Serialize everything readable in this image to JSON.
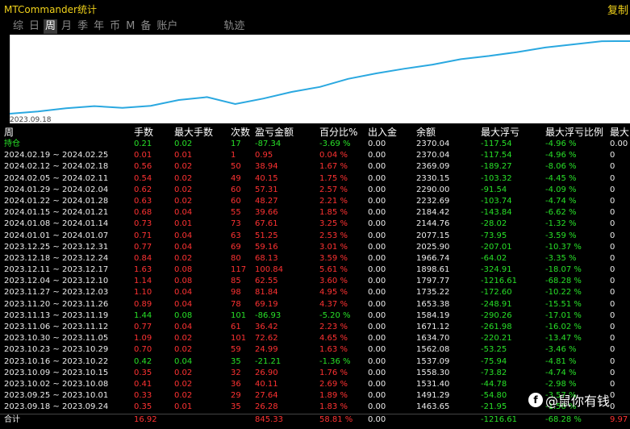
{
  "app": {
    "title": "MTCommander统计",
    "top_right": "复制"
  },
  "tabs": [
    {
      "label": "综",
      "active": false
    },
    {
      "label": "日",
      "active": false
    },
    {
      "label": "周",
      "active": true
    },
    {
      "label": "月",
      "active": false
    },
    {
      "label": "季",
      "active": false
    },
    {
      "label": "年",
      "active": false
    },
    {
      "label": "币",
      "active": false
    },
    {
      "label": "M",
      "active": false
    },
    {
      "label": "备",
      "active": false
    },
    {
      "label": "账户",
      "active": false
    },
    {
      "label": "轨迹",
      "active": false
    }
  ],
  "chart_data": {
    "type": "line",
    "x_start_label": "2023.09.18",
    "color": "#2aa8e0",
    "values": [
      1463.65,
      1491.29,
      1531.4,
      1558.3,
      1537.09,
      1562.08,
      1634.7,
      1671.12,
      1584.19,
      1653.38,
      1735.22,
      1797.77,
      1898.61,
      1966.74,
      2025.9,
      2077.15,
      2144.76,
      2184.42,
      2232.69,
      2290.0,
      2330.15,
      2369.09,
      2370.04
    ]
  },
  "table": {
    "headers": [
      "周",
      "手数",
      "最大手数",
      "次数",
      "盈亏金额",
      "百分比%",
      "出入金",
      "余额",
      "最大浮亏",
      "最大浮亏比例",
      "最大"
    ],
    "rows": [
      [
        "持仓",
        "0.21",
        "0.02",
        "17",
        "-87.34",
        "-3.69 %",
        "0.00",
        "2370.04",
        "-117.54",
        "-4.96 %",
        "0.00"
      ],
      [
        "2024.02.19 ~ 2024.02.25",
        "0.01",
        "0.01",
        "1",
        "0.95",
        "0.04 %",
        "0.00",
        "2370.04",
        "-117.54",
        "-4.96 %",
        "0"
      ],
      [
        "2024.02.12 ~ 2024.02.18",
        "0.56",
        "0.02",
        "50",
        "38.94",
        "1.67 %",
        "0.00",
        "2369.09",
        "-189.27",
        "-8.06 %",
        "0"
      ],
      [
        "2024.02.05 ~ 2024.02.11",
        "0.54",
        "0.02",
        "49",
        "40.15",
        "1.75 %",
        "0.00",
        "2330.15",
        "-103.32",
        "-4.45 %",
        "0"
      ],
      [
        "2024.01.29 ~ 2024.02.04",
        "0.62",
        "0.02",
        "60",
        "57.31",
        "2.57 %",
        "0.00",
        "2290.00",
        "-91.54",
        "-4.09 %",
        "0"
      ],
      [
        "2024.01.22 ~ 2024.01.28",
        "0.63",
        "0.02",
        "60",
        "48.27",
        "2.21 %",
        "0.00",
        "2232.69",
        "-103.74",
        "-4.74 %",
        "0"
      ],
      [
        "2024.01.15 ~ 2024.01.21",
        "0.68",
        "0.04",
        "55",
        "39.66",
        "1.85 %",
        "0.00",
        "2184.42",
        "-143.84",
        "-6.62 %",
        "0"
      ],
      [
        "2024.01.08 ~ 2024.01.14",
        "0.73",
        "0.01",
        "73",
        "67.61",
        "3.25 %",
        "0.00",
        "2144.76",
        "-28.02",
        "-1.32 %",
        "0"
      ],
      [
        "2024.01.01 ~ 2024.01.07",
        "0.71",
        "0.04",
        "63",
        "51.25",
        "2.53 %",
        "0.00",
        "2077.15",
        "-73.95",
        "-3.59 %",
        "0"
      ],
      [
        "2023.12.25 ~ 2023.12.31",
        "0.77",
        "0.04",
        "69",
        "59.16",
        "3.01 %",
        "0.00",
        "2025.90",
        "-207.01",
        "-10.37 %",
        "0"
      ],
      [
        "2023.12.18 ~ 2023.12.24",
        "0.84",
        "0.02",
        "80",
        "68.13",
        "3.59 %",
        "0.00",
        "1966.74",
        "-64.02",
        "-3.35 %",
        "0"
      ],
      [
        "2023.12.11 ~ 2023.12.17",
        "1.63",
        "0.08",
        "117",
        "100.84",
        "5.61 %",
        "0.00",
        "1898.61",
        "-324.91",
        "-18.07 %",
        "0"
      ],
      [
        "2023.12.04 ~ 2023.12.10",
        "1.14",
        "0.08",
        "85",
        "62.55",
        "3.60 %",
        "0.00",
        "1797.77",
        "-1216.61",
        "-68.28 %",
        "0"
      ],
      [
        "2023.11.27 ~ 2023.12.03",
        "1.10",
        "0.04",
        "98",
        "81.84",
        "4.95 %",
        "0.00",
        "1735.22",
        "-172.60",
        "-10.22 %",
        "0"
      ],
      [
        "2023.11.20 ~ 2023.11.26",
        "0.89",
        "0.04",
        "78",
        "69.19",
        "4.37 %",
        "0.00",
        "1653.38",
        "-248.91",
        "-15.51 %",
        "0"
      ],
      [
        "2023.11.13 ~ 2023.11.19",
        "1.44",
        "0.08",
        "101",
        "-86.93",
        "-5.20 %",
        "0.00",
        "1584.19",
        "-290.26",
        "-17.01 %",
        "0"
      ],
      [
        "2023.11.06 ~ 2023.11.12",
        "0.77",
        "0.04",
        "61",
        "36.42",
        "2.23 %",
        "0.00",
        "1671.12",
        "-261.98",
        "-16.02 %",
        "0"
      ],
      [
        "2023.10.30 ~ 2023.11.05",
        "1.09",
        "0.02",
        "101",
        "72.62",
        "4.65 %",
        "0.00",
        "1634.70",
        "-220.21",
        "-13.47 %",
        "0"
      ],
      [
        "2023.10.23 ~ 2023.10.29",
        "0.70",
        "0.02",
        "59",
        "24.99",
        "1.63 %",
        "0.00",
        "1562.08",
        "-53.25",
        "-3.46 %",
        "0"
      ],
      [
        "2023.10.16 ~ 2023.10.22",
        "0.42",
        "0.04",
        "35",
        "-21.21",
        "-1.36 %",
        "0.00",
        "1537.09",
        "-75.94",
        "-4.81 %",
        "0"
      ],
      [
        "2023.10.09 ~ 2023.10.15",
        "0.35",
        "0.02",
        "32",
        "26.90",
        "1.76 %",
        "0.00",
        "1558.30",
        "-73.82",
        "-4.74 %",
        "0"
      ],
      [
        "2023.10.02 ~ 2023.10.08",
        "0.41",
        "0.02",
        "36",
        "40.11",
        "2.69 %",
        "0.00",
        "1531.40",
        "-44.78",
        "-2.98 %",
        "0"
      ],
      [
        "2023.09.25 ~ 2023.10.01",
        "0.33",
        "0.02",
        "29",
        "27.64",
        "1.89 %",
        "0.00",
        "1491.29",
        "-54.80",
        "-3.57 %",
        "0"
      ],
      [
        "2023.09.18 ~ 2023.09.24",
        "0.35",
        "0.01",
        "35",
        "26.28",
        "1.83 %",
        "0.00",
        "1463.65",
        "-21.95",
        "-1.50 %",
        "0"
      ]
    ],
    "footer": [
      "合计",
      "16.92",
      "",
      "",
      "845.33",
      "58.81 %",
      "0.00",
      "",
      "-1216.61",
      "-68.28 %",
      "9.97"
    ]
  },
  "watermark": {
    "icon": "facebook-icon",
    "text": "@鼠你有钱"
  }
}
